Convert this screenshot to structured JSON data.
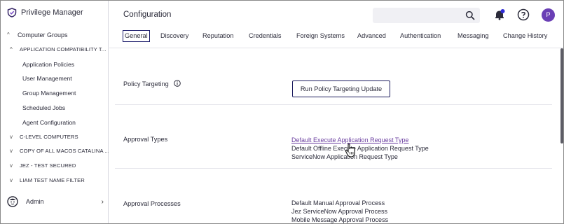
{
  "app": {
    "name": "Privilege Manager"
  },
  "sidebar": {
    "items": [
      {
        "label": "Computer Groups",
        "chevron": "^"
      },
      {
        "label": "APPLICATION COMPATIBILITY T...",
        "chevron": "^"
      },
      {
        "label": "Application Policies"
      },
      {
        "label": "User Management"
      },
      {
        "label": "Group Management"
      },
      {
        "label": "Scheduled Jobs"
      },
      {
        "label": "Agent Configuration"
      },
      {
        "label": "C-LEVEL COMPUTERS",
        "chevron": "v"
      },
      {
        "label": "COPY OF ALL MACOS CATALINA ...",
        "chevron": "v"
      },
      {
        "label": "JEZ - TEST SECURED",
        "chevron": "v"
      },
      {
        "label": "LIAM TEST NAME FILTER",
        "chevron": "v"
      }
    ],
    "admin": {
      "label": "Admin",
      "arrow": "›"
    }
  },
  "header": {
    "title": "Configuration",
    "search": {
      "placeholder": ""
    },
    "avatar_letter": "P",
    "accent_color": "#6a3fb5",
    "tabs": [
      {
        "label": "General",
        "active": true
      },
      {
        "label": "Discovery"
      },
      {
        "label": "Reputation"
      },
      {
        "label": "Credentials"
      },
      {
        "label": "Foreign Systems"
      },
      {
        "label": "Advanced"
      },
      {
        "label": "Authentication"
      },
      {
        "label": "Messaging"
      },
      {
        "label": "Change History"
      }
    ]
  },
  "content": {
    "policy_targeting": {
      "label": "Policy Targeting",
      "icon": "info-icon",
      "button": "Run Policy Targeting Update"
    },
    "approval_types": {
      "label": "Approval Types",
      "links": [
        "Default Execute Application Request Type",
        "Default Offline Execute Application Request Type",
        "ServiceNow Application Request Type"
      ]
    },
    "approval_processes": {
      "label": "Approval Processes",
      "links": [
        "Default Manual Approval Process",
        "Jez ServiceNow Approval Process",
        "Mobile Message Approval Process"
      ]
    }
  }
}
